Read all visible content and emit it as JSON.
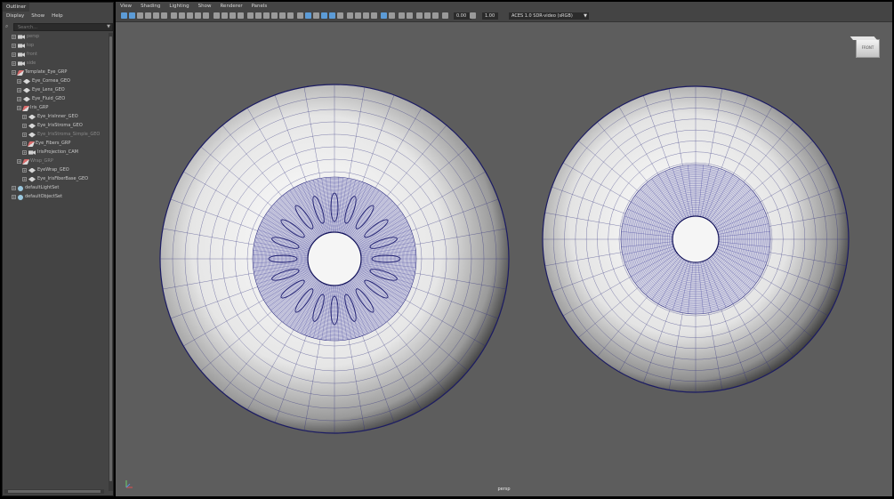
{
  "outliner": {
    "tab": "Outliner",
    "menus": [
      "Display",
      "Show",
      "Help"
    ],
    "search_placeholder": "Search...",
    "items": [
      {
        "label": "persp",
        "icon": "camera-icon",
        "level": 0,
        "dim": true
      },
      {
        "label": "top",
        "icon": "camera-icon",
        "level": 0,
        "dim": true
      },
      {
        "label": "front",
        "icon": "camera-icon",
        "level": 0,
        "dim": true
      },
      {
        "label": "side",
        "icon": "camera-icon",
        "level": 0,
        "dim": true
      },
      {
        "label": "Template_Eye_GRP",
        "icon": "group-icon",
        "level": 0,
        "dim": false
      },
      {
        "label": "Eye_Cornea_GEO",
        "icon": "mesh-icon",
        "level": 1,
        "dim": false
      },
      {
        "label": "Eye_Lens_GEO",
        "icon": "mesh-icon",
        "level": 1,
        "dim": false
      },
      {
        "label": "Eye_Fluid_GEO",
        "icon": "mesh-icon",
        "level": 1,
        "dim": false
      },
      {
        "label": "Iris_GRP",
        "icon": "group-icon",
        "level": 1,
        "dim": false
      },
      {
        "label": "Eye_IrisInner_GEO",
        "icon": "mesh-icon",
        "level": 2,
        "dim": false
      },
      {
        "label": "Eye_IrisStroma_GEO",
        "icon": "mesh-icon",
        "level": 2,
        "dim": false
      },
      {
        "label": "Eye_IrisStroma_Simple_GEO",
        "icon": "mesh-icon",
        "level": 2,
        "dim": true
      },
      {
        "label": "Eye_Fibers_GRP",
        "icon": "group-icon",
        "level": 2,
        "dim": false
      },
      {
        "label": "IrisProjection_CAM",
        "icon": "camera-icon",
        "level": 2,
        "dim": false
      },
      {
        "label": "Wrap_GRP",
        "icon": "group-icon",
        "level": 1,
        "dim": true
      },
      {
        "label": "EyeWrap_GEO",
        "icon": "mesh-icon",
        "level": 2,
        "dim": false
      },
      {
        "label": "Eye_IrisFiberBase_GEO",
        "icon": "mesh-icon",
        "level": 2,
        "dim": false
      },
      {
        "label": "defaultLightSet",
        "icon": "set-icon",
        "level": 0,
        "dim": false
      },
      {
        "label": "defaultObjectSet",
        "icon": "set-icon",
        "level": 0,
        "dim": false
      }
    ]
  },
  "viewport": {
    "menus": [
      "View",
      "Shading",
      "Lighting",
      "Show",
      "Renderer",
      "Panels"
    ],
    "exposure": "0.00",
    "gamma": "1.00",
    "color_space": "ACES 1.0 SDR-video (sRGB)",
    "viewcube_label": "FRONT",
    "camera_label": "persp"
  }
}
